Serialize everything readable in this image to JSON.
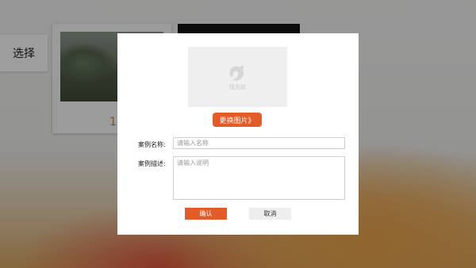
{
  "background": {
    "select_label": "选择",
    "card_number": "1"
  },
  "modal": {
    "thumbnail": {
      "placeholder_text": "找先前",
      "icon": "logo-icon"
    },
    "change_image_button": "更换图片》",
    "name_label": "案例名称:",
    "name_placeholder": "请输入名称",
    "name_value": "",
    "desc_label": "案例描述:",
    "desc_placeholder": "请输入说明",
    "desc_value": "",
    "confirm_button": "确认",
    "cancel_button": "取消"
  },
  "colors": {
    "accent": "#e35b27",
    "overlay": "rgba(0,0,0,0.38)",
    "cancel_bg": "#eeeeee"
  }
}
